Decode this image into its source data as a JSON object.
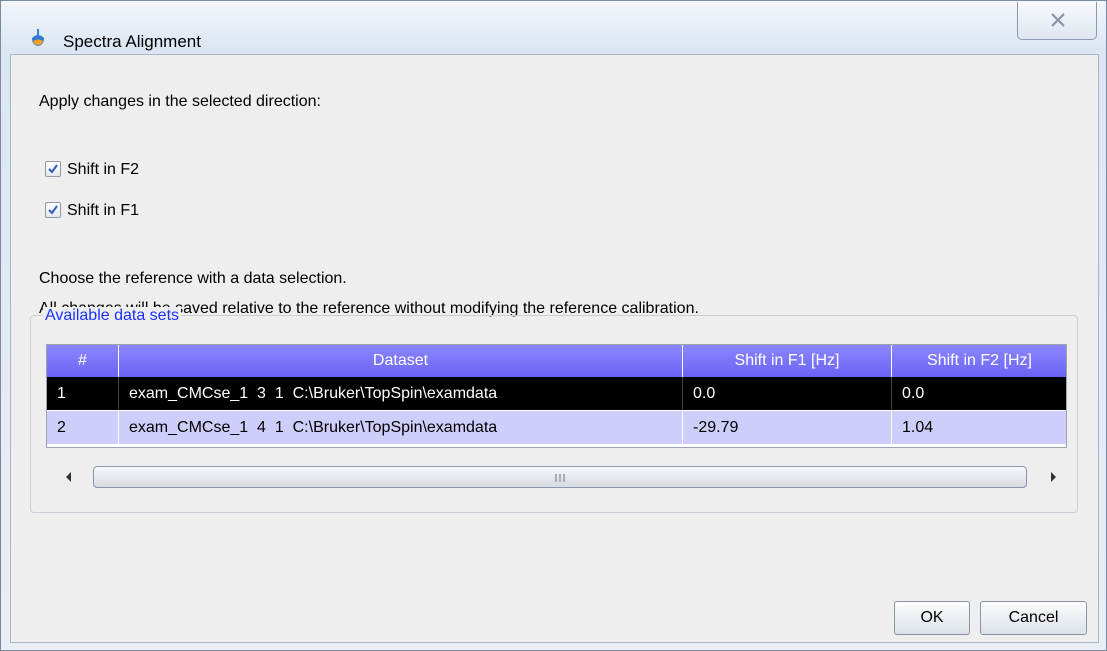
{
  "window": {
    "title": "Spectra Alignment",
    "icon": "topspin-app-icon",
    "close_icon": "close-x-icon"
  },
  "direction": {
    "heading": "Apply changes in the selected direction:",
    "options": [
      {
        "label": "Shift in F2",
        "checked": true
      },
      {
        "label": "Shift in F1",
        "checked": true
      }
    ]
  },
  "info": {
    "line1": "Choose the reference with a data selection.",
    "line2": "All changes will be saved relative to the reference without modifying the reference calibration."
  },
  "datasets": {
    "group_title": "Available data sets",
    "columns": [
      "#",
      "Dataset",
      "Shift in F1 [Hz]",
      "Shift in F2 [Hz]"
    ],
    "rows": [
      {
        "num": "1",
        "dataset": "exam_CMCse_1  3  1  C:\\Bruker\\TopSpin\\examdata",
        "f1": "0.0",
        "f2": "0.0",
        "selected": true
      },
      {
        "num": "2",
        "dataset": "exam_CMCse_1  4  1  C:\\Bruker\\TopSpin\\examdata",
        "f1": "-29.79",
        "f2": "1.04",
        "selected": false
      }
    ],
    "scrollbar_grip": "III"
  },
  "buttons": {
    "ok": "OK",
    "cancel": "Cancel"
  },
  "colors": {
    "header_bg": "#7a74fb",
    "selected_row_bg": "#000000",
    "alt_row_bg": "#cfcdfa",
    "group_title": "#1a32ff"
  }
}
